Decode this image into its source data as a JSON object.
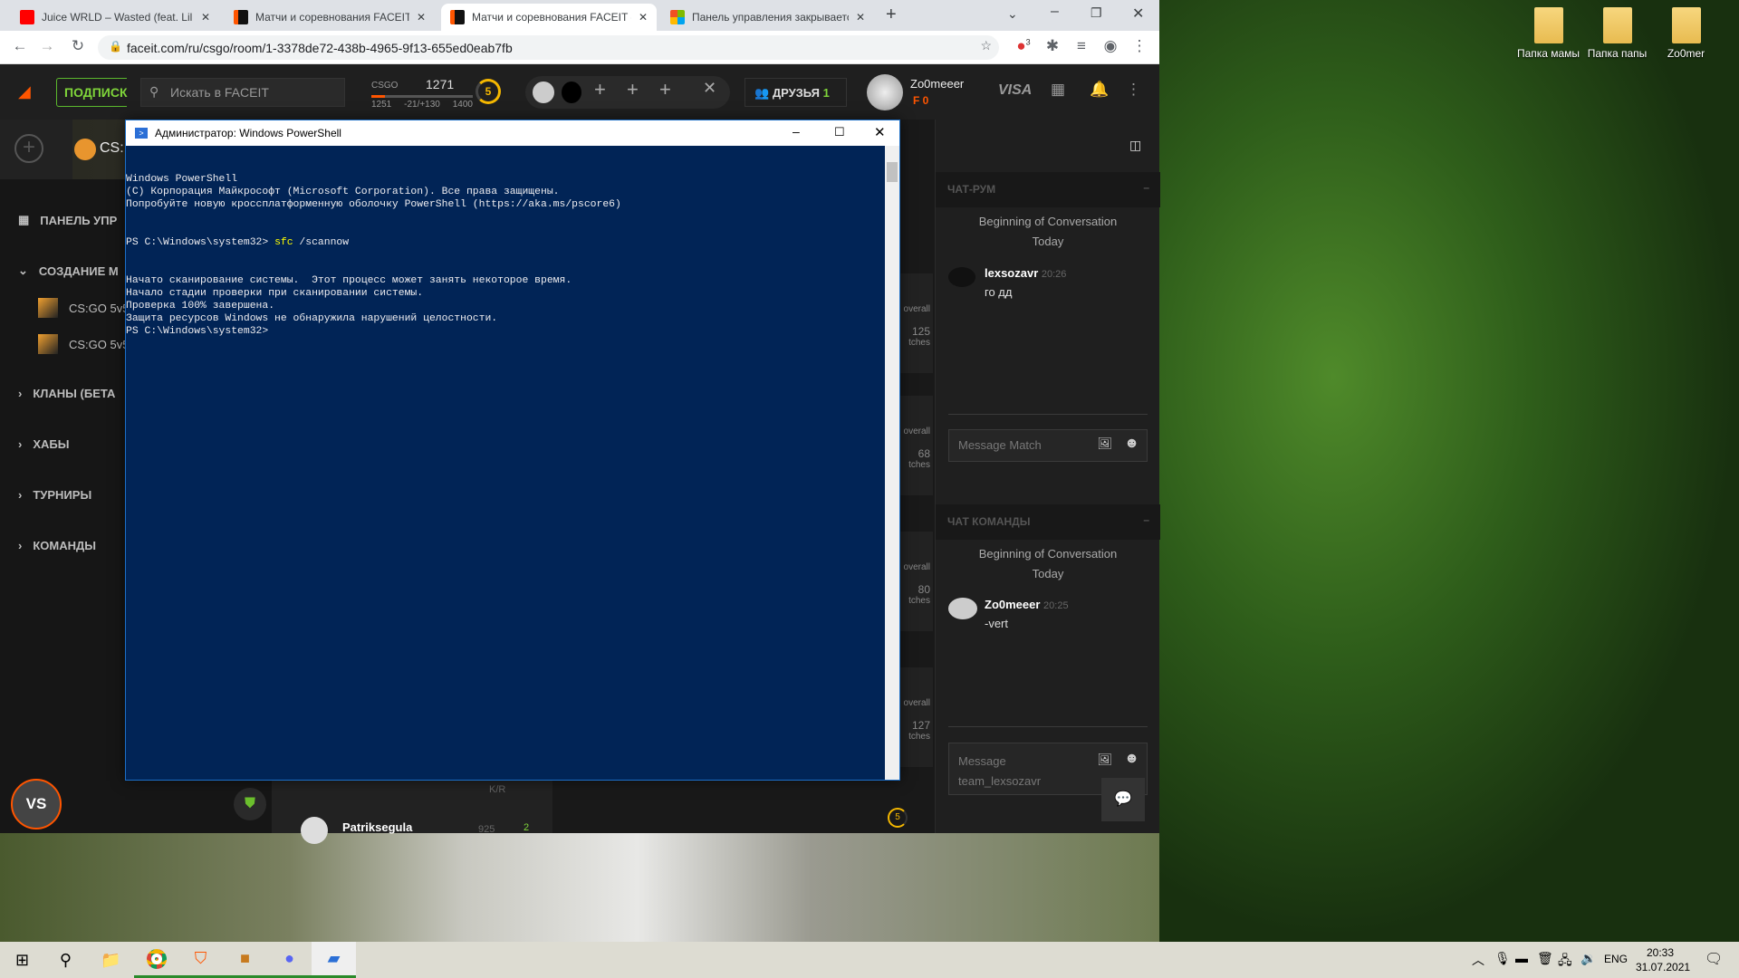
{
  "browser": {
    "tabs": [
      {
        "title": "Juice WRLD – Wasted (feat. Lil Uzi",
        "icon": "youtube-icon",
        "active": false
      },
      {
        "title": "Матчи и соревнования FACEIT -",
        "icon": "faceit-icon",
        "active": false
      },
      {
        "title": "Матчи и соревнования FACEIT -",
        "icon": "faceit-icon",
        "active": true
      },
      {
        "title": "Панель управления закрывается",
        "icon": "microsoft-icon",
        "active": false
      }
    ],
    "url": "faceit.com/ru/csgo/room/1-3378de72-438b-4965-9f13-655ed0eab7fb",
    "extension_badge": "3"
  },
  "faceit": {
    "subscribe": "ПОДПИСК",
    "search_placeholder": "Искать в FACEIT",
    "game": "CSGO",
    "elo": "1271",
    "elo_min": "1251",
    "elo_delta": "-21/+130",
    "elo_max": "1400",
    "level": "5",
    "elo_progress": 0.13,
    "friends_label": "ДРУЗЬЯ",
    "friends_count": "1",
    "username": "Zo0meeer",
    "points": "0",
    "visa": "VISA",
    "game_header": "CS:",
    "sidebar": [
      {
        "label": "ПАНЕЛЬ УПР",
        "icon": "grid-icon"
      },
      {
        "label": "СОЗДАНИЕ М",
        "icon": "chevron-down-icon"
      },
      {
        "label": "CS:GO 5v5",
        "icon": "csgo-icon"
      },
      {
        "label": "CS:GO 5v5",
        "icon": "csgo-icon"
      },
      {
        "label": "КЛАНЫ (БЕТА",
        "icon": "chevron-right-icon"
      },
      {
        "label": "ХАБЫ",
        "icon": "chevron-right-icon"
      },
      {
        "label": "ТУРНИРЫ",
        "icon": "chevron-right-icon"
      },
      {
        "label": "КОМАНДЫ",
        "icon": "chevron-right-icon"
      }
    ],
    "vs": "VS",
    "kr_label": "K/R",
    "player": "Patriksegula",
    "player_elo": "925",
    "player_level": "2",
    "stats": [
      {
        "label": "overall",
        "value": "125",
        "unit": "tches"
      },
      {
        "label": "overall",
        "value": "68",
        "unit": "tches"
      },
      {
        "label": "overall",
        "value": "80",
        "unit": "tches"
      },
      {
        "label": "overall",
        "value": "127",
        "unit": "tches"
      }
    ],
    "right_level": "5",
    "chat_room": {
      "title": "ЧАТ-РУМ",
      "begin": "Beginning of Conversation",
      "day": "Today",
      "messages": [
        {
          "user": "lexsozavr",
          "time": "20:26",
          "text": "го дд"
        }
      ],
      "placeholder": "Message Match"
    },
    "team_chat": {
      "title": "ЧАТ КОМАНДЫ",
      "begin": "Beginning of Conversation",
      "day": "Today",
      "messages": [
        {
          "user": "Zo0meeer",
          "time": "20:25",
          "text": "-vert"
        }
      ],
      "placeholder": "Message team_lexsozavr"
    }
  },
  "powershell": {
    "title": "Администратор: Windows PowerShell",
    "lines": [
      "Windows PowerShell",
      "(C) Корпорация Майкрософт (Microsoft Corporation). Все права защищены.",
      "",
      "Попробуйте новую кроссплатформенную оболочку PowerShell (https://aka.ms/pscore6)",
      "",
      "",
      "",
      "Начато сканирование системы.  Этот процесс может занять некоторое время.",
      "",
      "Начало стадии проверки при сканировании системы.",
      "Проверка 100% завершена.",
      "",
      "Защита ресурсов Windows не обнаружила нарушений целостности.",
      "PS C:\\Windows\\system32>"
    ],
    "prompt": "PS C:\\Windows\\system32> ",
    "cmd": "sfc",
    "cmd_args": " /scannow"
  },
  "desktop": {
    "icons": [
      "Папка мамы",
      "Папка папы",
      "Zo0mer"
    ]
  },
  "tray": {
    "lang": "ENG",
    "time": "20:33",
    "date": "31.07.2021"
  }
}
